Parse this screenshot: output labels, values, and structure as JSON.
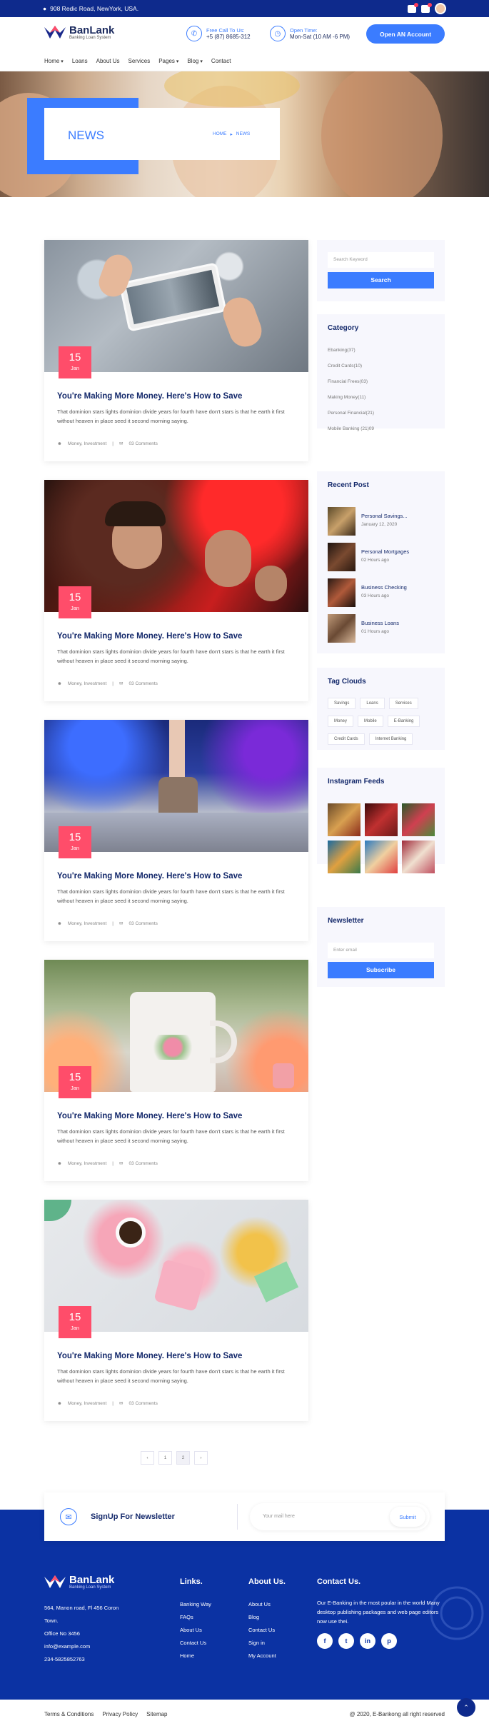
{
  "topbar": {
    "address": "908 Redic Road, NewYork, USA.",
    "icons": [
      "mail-icon",
      "bell-icon",
      "avatar"
    ]
  },
  "header": {
    "logo_name": "BanLank",
    "logo_sub": "Banking Loan System",
    "call_label": "Free Call To Us:",
    "call_value": "+5 (87) 8685-312",
    "time_label": "Open Time:",
    "time_value": "Mon-Sat (10 AM -6 PM)",
    "cta": "Open AN Account"
  },
  "nav": [
    "Home",
    "Loans",
    "About Us",
    "Services",
    "Pages",
    "Blog",
    "Contact"
  ],
  "banner": {
    "title": "NEWS",
    "crumb_home": "HOME",
    "crumb_current": "NEWS"
  },
  "posts": [
    {
      "day": "15",
      "month": "Jan",
      "title": "You're Making More Money. Here's How to Save",
      "excerpt": "That dominion stars lights dominion divide years for fourth have don't stars is that he earth it first without heaven in place seed it second morning saying.",
      "category": "Money, Investment",
      "comments": "03 Comments"
    },
    {
      "day": "15",
      "month": "Jan",
      "title": "You're Making More Money. Here's How to Save",
      "excerpt": "That dominion stars lights dominion divide years for fourth have don't stars is that he earth it first without heaven in place seed it second morning saying.",
      "category": "Money, Investment",
      "comments": "03 Comments"
    },
    {
      "day": "15",
      "month": "Jan",
      "title": "You're Making More Money. Here's How to Save",
      "excerpt": "That dominion stars lights dominion divide years for fourth have don't stars is that he earth it first without heaven in place seed it second morning saying.",
      "category": "Money, Investment",
      "comments": "03 Comments"
    },
    {
      "day": "15",
      "month": "Jan",
      "title": "You're Making More Money. Here's How to Save",
      "excerpt": "That dominion stars lights dominion divide years for fourth have don't stars is that he earth it first without heaven in place seed it second morning saying.",
      "category": "Money, Investment",
      "comments": "03 Comments"
    },
    {
      "day": "15",
      "month": "Jan",
      "title": "You're Making More Money. Here's How to Save",
      "excerpt": "That dominion stars lights dominion divide years for fourth have don't stars is that he earth it first without heaven in place seed it second morning saying.",
      "category": "Money, Investment",
      "comments": "03 Comments"
    }
  ],
  "sidebar": {
    "search_placeholder": "Search Keyword",
    "search_button": "Search",
    "category_title": "Category",
    "categories": [
      "Ebanking(37)",
      "Credit Cards(10)",
      "Financial Frees(03)",
      "Making Money(11)",
      "Personal Financial(21)",
      "Mobile Banking (21)09"
    ],
    "recent_title": "Recent Post",
    "recent": [
      {
        "title": "Personal Savings...",
        "date": "January 12, 2020"
      },
      {
        "title": "Personal Mortgages",
        "date": "02 Hours ago"
      },
      {
        "title": "Business Checking",
        "date": "03 Hours ago"
      },
      {
        "title": "Business Loans",
        "date": "01 Hours ago"
      }
    ],
    "tags_title": "Tag Clouds",
    "tags": [
      "Savings",
      "Loans",
      "Services",
      "Money",
      "Mobile",
      "E-Banking",
      "Credit Cards",
      "Internet Banking"
    ],
    "insta_title": "Instagram Feeds",
    "newsletter_title": "Newsletter",
    "newsletter_placeholder": "Enter email",
    "newsletter_button": "Subscribe"
  },
  "pagination": [
    "‹",
    "1",
    "2",
    "›"
  ],
  "newsletter_bar": {
    "title": "SignUp For Newsletter",
    "placeholder": "Your mail here",
    "button": "Submit"
  },
  "footer": {
    "logo_name": "BanLank",
    "logo_sub": "Banking Loan System",
    "address1": "564, Manon road, Fl 456 Coron",
    "address2": "Town.",
    "office": "Office No 3456",
    "email": "info@example.com",
    "phone": "234-5825852763",
    "links_title": "Links.",
    "links": [
      "Banking Way",
      "FAQs",
      "About Us",
      "Contact Us",
      "Home"
    ],
    "about_title": "About Us.",
    "about": [
      "About Us",
      "Blog",
      "Contact Us",
      "Sign in",
      "My Account"
    ],
    "contact_title": "Contact Us.",
    "contact_text": "Our E-Banking in the most poular in the world Many desktop publishing packages and web page editors now use thei.",
    "social": [
      "f",
      "t",
      "in",
      "p"
    ],
    "bottom_links": [
      "Terms & Conditions",
      "Privacy Policy",
      "Sitemap"
    ],
    "copyright": "@ 2020, E-Bankong all right reserved"
  }
}
